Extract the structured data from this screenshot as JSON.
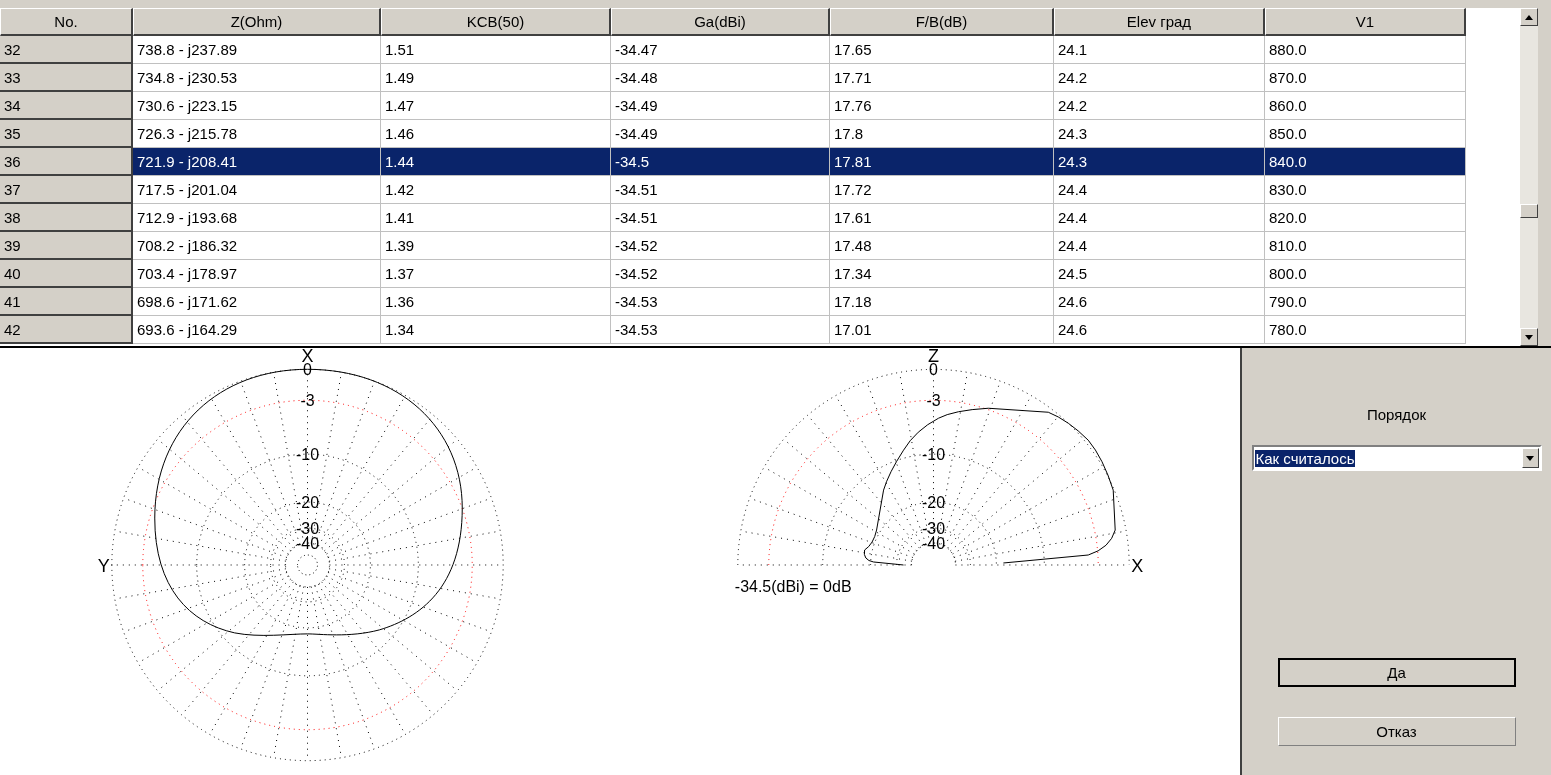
{
  "table": {
    "columns": [
      "No.",
      "Z(Ohm)",
      "KCB(50)",
      "Ga(dBi)",
      "F/B(dB)",
      "Elev град",
      "V1"
    ],
    "rows": [
      {
        "selected": false,
        "cells": [
          "32",
          "738.8 - j237.89",
          "1.51",
          "-34.47",
          "17.65",
          "24.1",
          "880.0"
        ]
      },
      {
        "selected": false,
        "cells": [
          "33",
          "734.8 - j230.53",
          "1.49",
          "-34.48",
          "17.71",
          "24.2",
          "870.0"
        ]
      },
      {
        "selected": false,
        "cells": [
          "34",
          "730.6 - j223.15",
          "1.47",
          "-34.49",
          "17.76",
          "24.2",
          "860.0"
        ]
      },
      {
        "selected": false,
        "cells": [
          "35",
          "726.3 - j215.78",
          "1.46",
          "-34.49",
          "17.8",
          "24.3",
          "850.0"
        ]
      },
      {
        "selected": true,
        "cells": [
          "36",
          "721.9 - j208.41",
          "1.44",
          "-34.5",
          "17.81",
          "24.3",
          "840.0"
        ]
      },
      {
        "selected": false,
        "cells": [
          "37",
          "717.5 - j201.04",
          "1.42",
          "-34.51",
          "17.72",
          "24.4",
          "830.0"
        ]
      },
      {
        "selected": false,
        "cells": [
          "38",
          "712.9 - j193.68",
          "1.41",
          "-34.51",
          "17.61",
          "24.4",
          "820.0"
        ]
      },
      {
        "selected": false,
        "cells": [
          "39",
          "708.2 - j186.32",
          "1.39",
          "-34.52",
          "17.48",
          "24.4",
          "810.0"
        ]
      },
      {
        "selected": false,
        "cells": [
          "40",
          "703.4 - j178.97",
          "1.37",
          "-34.52",
          "17.34",
          "24.5",
          "800.0"
        ]
      },
      {
        "selected": false,
        "cells": [
          "41",
          "698.6 - j171.62",
          "1.36",
          "-34.53",
          "17.18",
          "24.6",
          "790.0"
        ]
      },
      {
        "selected": false,
        "cells": [
          "42",
          "693.6 - j164.29",
          "1.34",
          "-34.53",
          "17.01",
          "24.6",
          "780.0"
        ]
      }
    ]
  },
  "plots": [
    {
      "kind": "full",
      "axis_top": "X",
      "axis_side": "Y",
      "ring_labels": [
        "0",
        "-3",
        "-10",
        "-20",
        "-30",
        "-40"
      ]
    },
    {
      "kind": "half",
      "axis_top": "Z",
      "axis_side": "X",
      "ring_labels": [
        "0",
        "-3",
        "-10",
        "-20",
        "-30",
        "-40"
      ],
      "note": "-34.5(dBi) = 0dB"
    }
  ],
  "panel": {
    "label": "Порядок",
    "dropdown": {
      "value": "Как считалось"
    },
    "buttons": [
      "Да",
      "Отказ"
    ]
  }
}
